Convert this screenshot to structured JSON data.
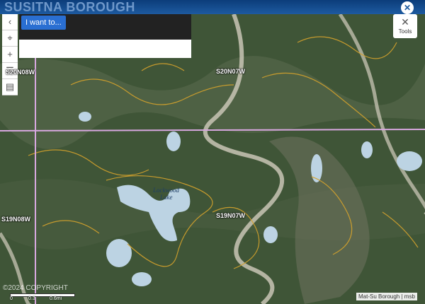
{
  "brand": {
    "name": "SUSITNA BOROUGH"
  },
  "window": {
    "close_icon": "close-icon"
  },
  "toolbar": {
    "back_icon": "chevron-left-icon",
    "locate_icon": "crosshair-icon",
    "zoom_in_icon": "plus-icon",
    "layers_icon": "layers-icon",
    "bookmark_icon": "book-icon"
  },
  "search": {
    "button_label": "I want to..."
  },
  "tools": {
    "label": "Tools",
    "icon": "tools-icon"
  },
  "map": {
    "section_labels": [
      "S20N07W",
      "S19N08W",
      "S19N07W",
      "S20N08W"
    ],
    "lake_name": "Lockwood Lake",
    "lake_label_line1": "Lockwood",
    "lake_label_line2": "Lake",
    "colors": {
      "terrain": "#3d5236",
      "lake": "#bcd3e3",
      "contour": "#d4a22c",
      "grid_line": "#d8a8e0"
    }
  },
  "scale": {
    "ticks": [
      "0",
      "0.3",
      "0.6mi"
    ]
  },
  "attribution": {
    "text": "Mat-Su Borough | msb"
  },
  "watermark": {
    "text": "©2024 COPYRIGHT"
  }
}
